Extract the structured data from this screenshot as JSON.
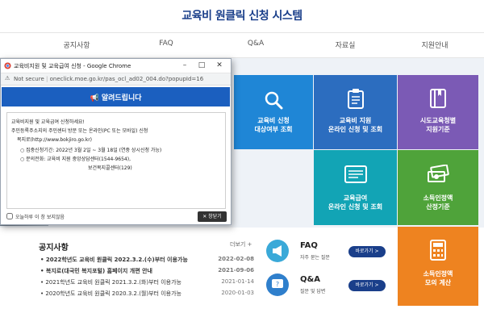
{
  "site": {
    "title": "교육비 원클릭 신청 시스템"
  },
  "nav": [
    "공지사항",
    "FAQ",
    "Q&A",
    "자료실",
    "지원안내"
  ],
  "tiles": [
    {
      "line1": "교육비 신청",
      "line2": "대상여부 조회",
      "icon": "magnifier-icon",
      "color": "#1f86d6"
    },
    {
      "line1": "교육비 지원",
      "line2": "온라인 신청 및 조회",
      "icon": "clipboard-icon",
      "color": "#2c6dbf"
    },
    {
      "line1": "시도교육청별",
      "line2": "지원기준",
      "icon": "book-icon",
      "color": "#7b5ab5"
    },
    {
      "line1": "교육급여",
      "line2": "온라인 신청 및 조회",
      "icon": "form-icon",
      "color": "#12a4b5"
    },
    {
      "line1": "소득인정액",
      "line2": "산정기준",
      "icon": "money-icon",
      "color": "#4fa33a"
    },
    {
      "line1": "소득인정액",
      "line2": "모의 계산",
      "icon": "calculator-icon",
      "color": "#ee8320"
    }
  ],
  "notice": {
    "title": "공지사항",
    "more": "더보기 +",
    "items": [
      {
        "text": "• 2022학년도 교육비 원클릭 2022.3.2.(수)부터 이용가능",
        "date": "2022-02-08",
        "bold": true
      },
      {
        "text": "• 복지로(대국민 복지포털) 홈페이지 개편 안내",
        "date": "2021-09-06",
        "bold": true
      },
      {
        "text": "• 2021학년도 교육비 원클릭 2021.3.2.(화)부터 이용가능",
        "date": "2021-01-14",
        "bold": false
      },
      {
        "text": "• 2020학년도 교육비 원클릭 2020.3.2.(월)부터 이용가능",
        "date": "2020-01-03",
        "bold": false
      }
    ]
  },
  "quick": {
    "faq": {
      "title": "FAQ",
      "sub": "자주 묻는 질문",
      "button": "바로가기 >"
    },
    "qna": {
      "title": "Q&A",
      "sub": "질문 및 답변",
      "button": "바로가기 >"
    }
  },
  "popup": {
    "window_title": "교육비지원 및 교육급여 신청 - Google Chrome",
    "not_secure": "Not secure",
    "url": "oneclick.moe.go.kr/pas_ocl_ad02_004.do?popupId=16",
    "header": "알려드립니다",
    "body": [
      "교육비지원 및 교육급여 신청하세요!",
      "주민등록주소지의 주민센터 방문 또는 온라인(PC 또는 모바일) 신청",
      "복지로(http://www.bokjiro.go.kr)",
      "○ 집중신청기간: 2022년 3월 2일 ~ 3월 18일 (연중 상시신청 가능)",
      "○ 문의전화: 교육비 지원 중앙상담센터(1544-9654),",
      "보건복지콜센터(129)"
    ],
    "dont_show": "오늘하루 이 창 보지않음",
    "close": "✕ 창닫기"
  }
}
